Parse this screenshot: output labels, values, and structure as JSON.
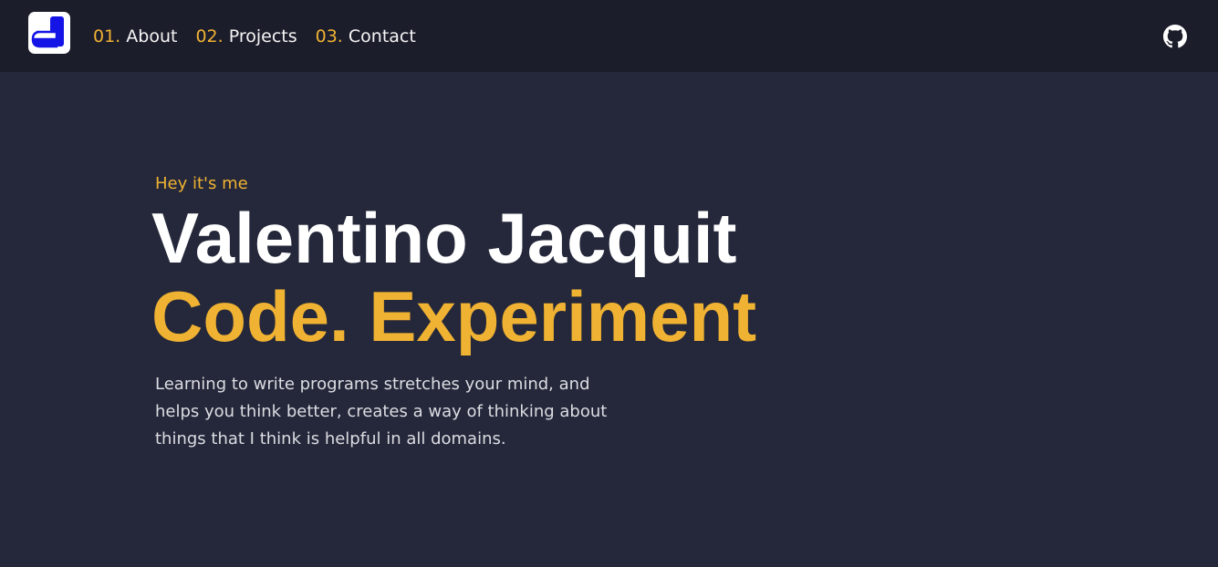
{
  "nav": {
    "logo_icon": "j-logo-icon",
    "links": [
      {
        "num": "01.",
        "label": "About"
      },
      {
        "num": "02.",
        "label": "Projects"
      },
      {
        "num": "03.",
        "label": "Contact"
      }
    ],
    "github_icon": "github-icon"
  },
  "hero": {
    "eyebrow": "Hey it's me",
    "name": "Valentino Jacquit",
    "tagline": "Code. Experiment",
    "description": "Learning to write programs stretches your mind, and helps you think better, creates a way of thinking about things that I think is helpful in all domains."
  },
  "colors": {
    "accent": "#f0b232",
    "background": "#25283a",
    "navbar": "#1c1d2b",
    "text": "#ffffff",
    "logo_blue": "#1414e6"
  }
}
